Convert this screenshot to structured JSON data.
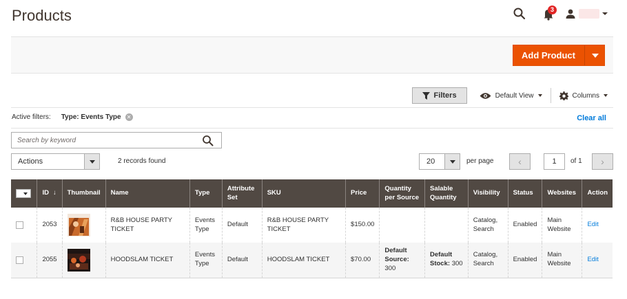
{
  "page_title": "Products",
  "header": {
    "notifications_count": "3"
  },
  "action_bar": {
    "add_product_label": "Add Product"
  },
  "toolbar": {
    "filters_label": "Filters",
    "view_label": "Default View",
    "columns_label": "Columns"
  },
  "active_filters": {
    "label": "Active filters:",
    "items": [
      "Type: Events Type"
    ],
    "clear_all_label": "Clear all"
  },
  "search": {
    "placeholder": "Search by keyword",
    "value": ""
  },
  "mass_actions": {
    "selected": "Actions"
  },
  "records_found": "2 records found",
  "pagination": {
    "per_page_value": "20",
    "per_page_label": "per page",
    "current_page": "1",
    "of_label": "of 1"
  },
  "table": {
    "columns": [
      "ID",
      "Thumbnail",
      "Name",
      "Type",
      "Attribute Set",
      "SKU",
      "Price",
      "Quantity per Source",
      "Salable Quantity",
      "Visibility",
      "Status",
      "Websites",
      "Action"
    ],
    "id_sort_indicator": "↓",
    "rows": [
      {
        "id": "2053",
        "name": "R&B HOUSE PARTY TICKET",
        "type": "Events Type",
        "attribute_set": "Default",
        "sku": "R&B HOUSE PARTY TICKET",
        "price": "$150.00",
        "qty_source_label": "",
        "qty_source_value": "",
        "salable_label": "",
        "salable_value": "",
        "visibility": "Catalog, Search",
        "status": "Enabled",
        "websites": "Main Website",
        "action": "Edit"
      },
      {
        "id": "2055",
        "name": "HOODSLAM TICKET",
        "type": "Events Type",
        "attribute_set": "Default",
        "sku": "HOODSLAM TICKET",
        "price": "$70.00",
        "qty_source_label": "Default Source:",
        "qty_source_value": "300",
        "salable_label": "Default Stock:",
        "salable_value": "300",
        "visibility": "Catalog, Search",
        "status": "Enabled",
        "websites": "Main Website",
        "action": "Edit"
      }
    ]
  },
  "colors": {
    "primary_button": "#eb5202",
    "table_header": "#514943",
    "link": "#007bdb",
    "badge": "#e22626"
  },
  "icons": [
    "search-icon",
    "bell-icon",
    "user-icon",
    "filter-icon",
    "eye-icon",
    "gear-icon",
    "close-icon",
    "chevron-left-icon",
    "chevron-right-icon"
  ]
}
